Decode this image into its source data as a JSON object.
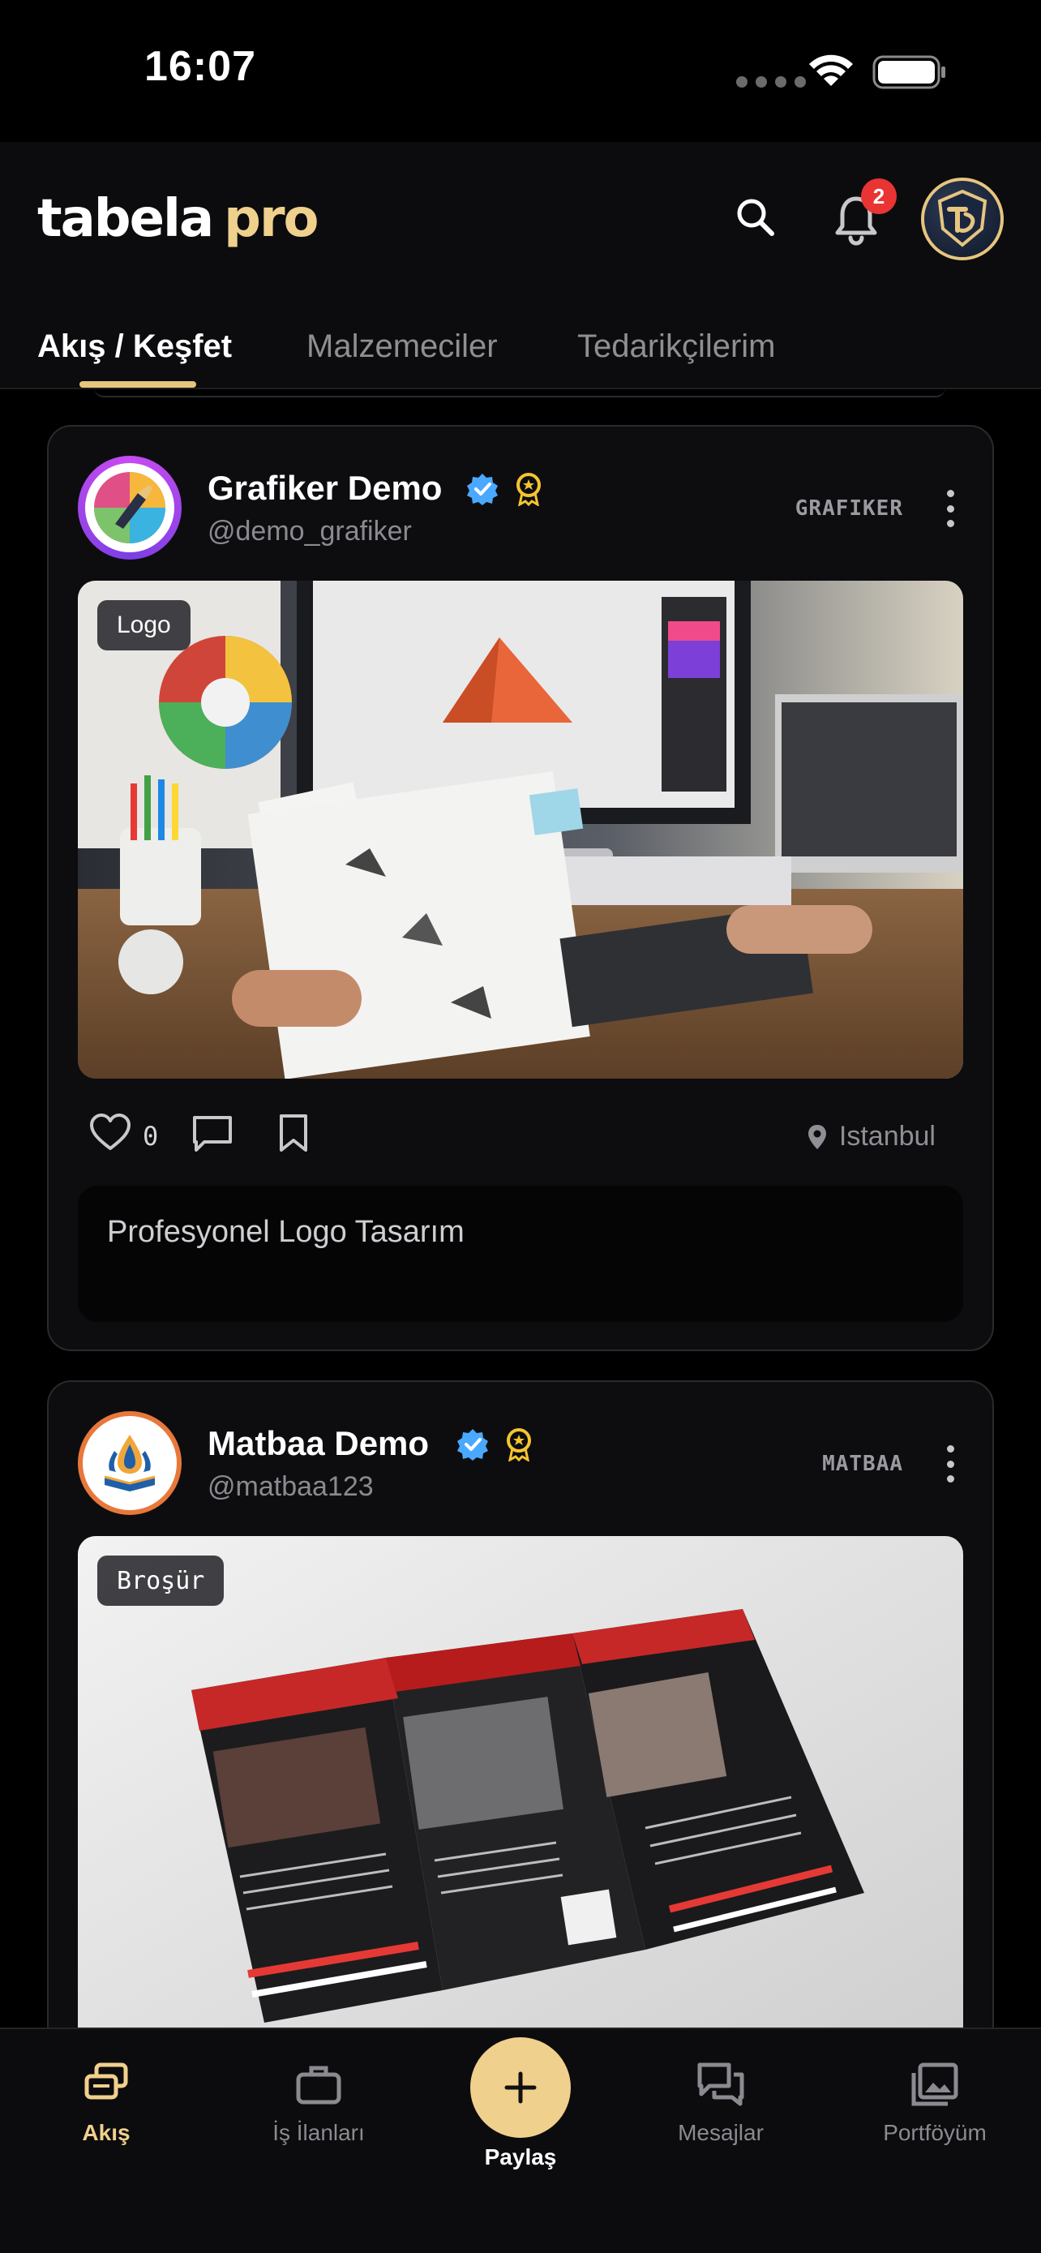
{
  "status_bar": {
    "time": "16:07"
  },
  "header": {
    "logo_primary": "tabela",
    "logo_accent": "pro",
    "notification_count": "2",
    "tabs": [
      {
        "label": "Akış / Keşfet",
        "active": true
      },
      {
        "label": "Malzemeciler",
        "active": false
      },
      {
        "label": "Tedarikçilerim",
        "active": false
      }
    ]
  },
  "feed": [
    {
      "name": "Grafiker Demo",
      "handle": "@demo_grafiker",
      "role": "GRAFIKER",
      "verified": true,
      "award": true,
      "image_tag": "Logo",
      "likes": "0",
      "location": "Istanbul",
      "caption": "Profesyonel Logo Tasarım"
    },
    {
      "name": "Matbaa Demo",
      "handle": "@matbaa123",
      "role": "MATBAA",
      "verified": true,
      "award": true,
      "image_tag": "Broşür"
    }
  ],
  "bottom_nav": {
    "items": [
      {
        "label": "Akış",
        "icon": "feed-icon",
        "active": true
      },
      {
        "label": "İş İlanları",
        "icon": "briefcase-icon",
        "active": false
      },
      {
        "label": "Paylaş",
        "icon": "plus-icon",
        "active": false
      },
      {
        "label": "Mesajlar",
        "icon": "chat-icon",
        "active": false
      },
      {
        "label": "Portföyüm",
        "icon": "gallery-icon",
        "active": false
      }
    ]
  },
  "colors": {
    "accent": "#f0d08d",
    "background": "#000000",
    "card": "#0d0d10",
    "badge": "#ea3434",
    "verified": "#4aa9ff",
    "award": "#f4c430"
  }
}
